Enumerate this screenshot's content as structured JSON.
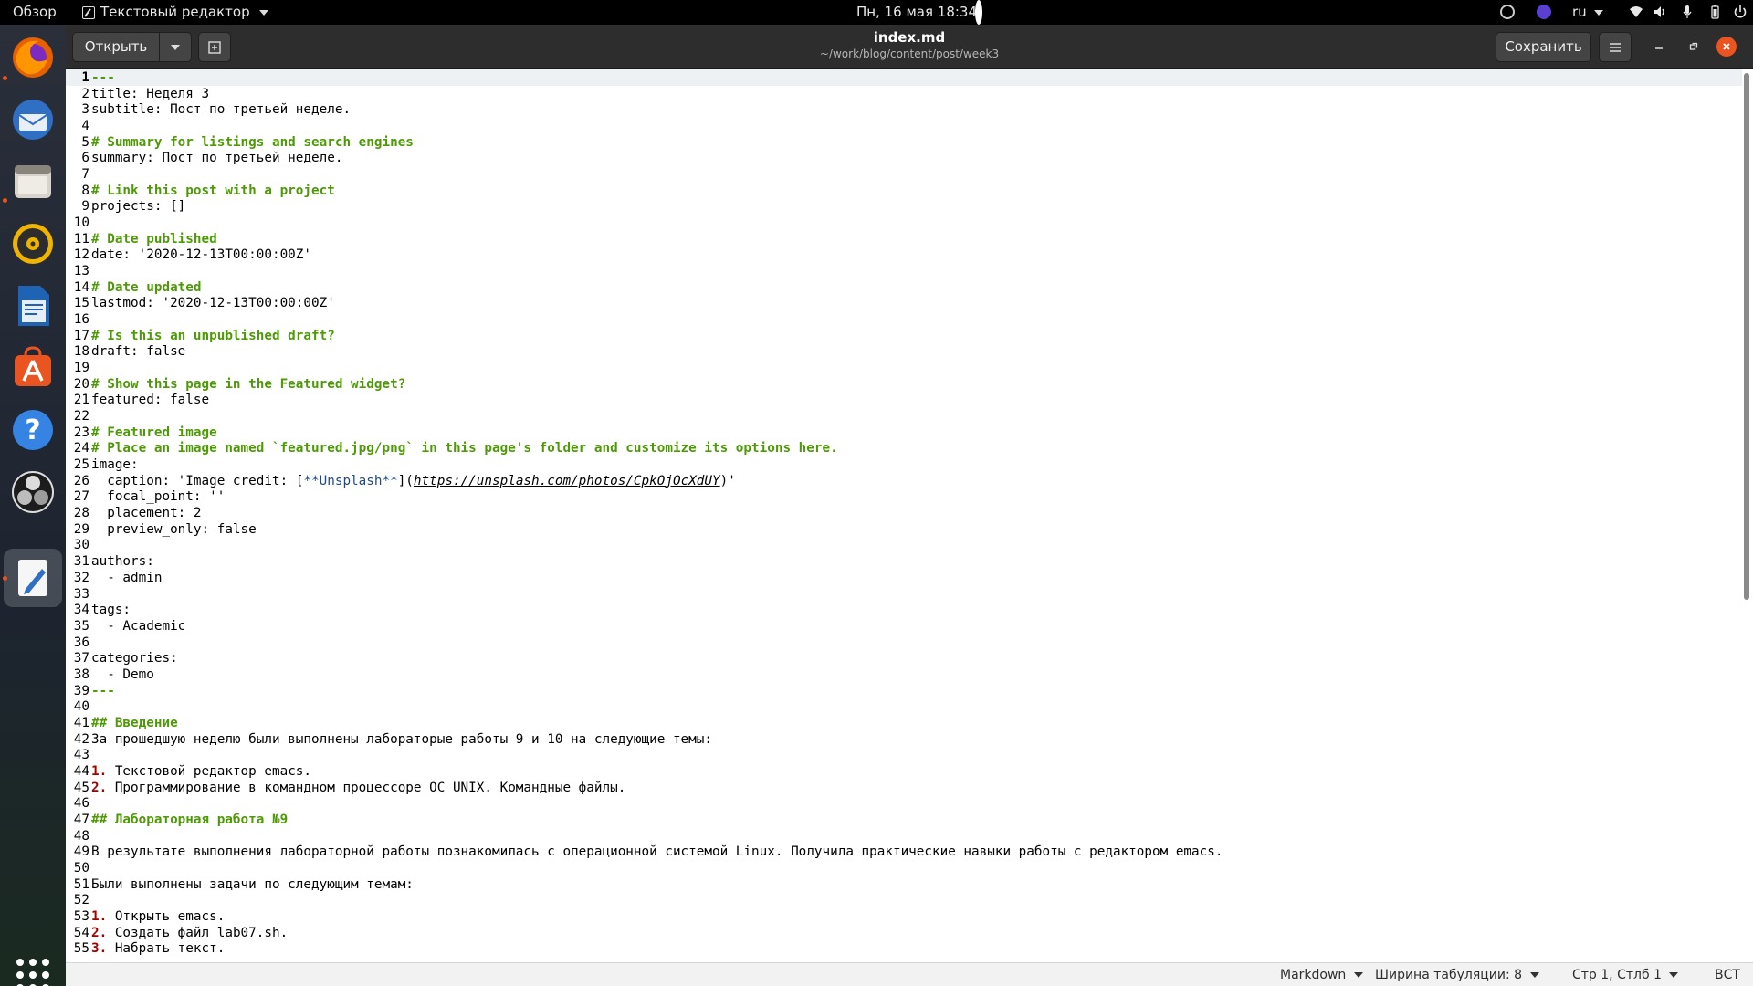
{
  "topbar": {
    "overview": "Обзор",
    "app_menu": "Текстовый редактор",
    "clock": "Пн, 16 мая  18:34",
    "lang": "ru"
  },
  "dock": {
    "items": [
      "firefox-icon",
      "thunderbird-icon",
      "files-icon",
      "rhythmbox-icon",
      "libreoffice-writer-icon",
      "software-center-icon",
      "help-icon",
      "obs-icon",
      "text-editor-icon"
    ]
  },
  "headerbar": {
    "open_label": "Открыть",
    "save_label": "Сохранить",
    "title": "index.md",
    "subtitle": "~/work/blog/content/post/week3"
  },
  "editor": {
    "lines": [
      {
        "n": "1",
        "segs": [
          {
            "t": "---",
            "c": "comment"
          }
        ]
      },
      {
        "n": "2",
        "segs": [
          {
            "t": "title: Неделя 3"
          }
        ]
      },
      {
        "n": "3",
        "segs": [
          {
            "t": "subtitle: Пост по третьей неделе."
          }
        ]
      },
      {
        "n": "4",
        "segs": []
      },
      {
        "n": "5",
        "segs": [
          {
            "t": "# Summary for listings and search engines",
            "c": "comment"
          }
        ]
      },
      {
        "n": "6",
        "segs": [
          {
            "t": "summary: Пост по третьей неделе."
          }
        ]
      },
      {
        "n": "7",
        "segs": []
      },
      {
        "n": "8",
        "segs": [
          {
            "t": "# Link this post with a project",
            "c": "comment"
          }
        ]
      },
      {
        "n": "9",
        "segs": [
          {
            "t": "projects: []"
          }
        ]
      },
      {
        "n": "10",
        "segs": []
      },
      {
        "n": "11",
        "segs": [
          {
            "t": "# Date published",
            "c": "comment"
          }
        ]
      },
      {
        "n": "12",
        "segs": [
          {
            "t": "date: '2020-12-13T00:00:00Z'"
          }
        ]
      },
      {
        "n": "13",
        "segs": []
      },
      {
        "n": "14",
        "segs": [
          {
            "t": "# Date updated",
            "c": "comment"
          }
        ]
      },
      {
        "n": "15",
        "segs": [
          {
            "t": "lastmod: '2020-12-13T00:00:00Z'"
          }
        ]
      },
      {
        "n": "16",
        "segs": []
      },
      {
        "n": "17",
        "segs": [
          {
            "t": "# Is this an unpublished draft?",
            "c": "comment"
          }
        ]
      },
      {
        "n": "18",
        "segs": [
          {
            "t": "draft: false"
          }
        ]
      },
      {
        "n": "19",
        "segs": []
      },
      {
        "n": "20",
        "segs": [
          {
            "t": "# Show this page in the Featured widget?",
            "c": "comment"
          }
        ]
      },
      {
        "n": "21",
        "segs": [
          {
            "t": "featured: false"
          }
        ]
      },
      {
        "n": "22",
        "segs": []
      },
      {
        "n": "23",
        "segs": [
          {
            "t": "# Featured image",
            "c": "comment"
          }
        ]
      },
      {
        "n": "24",
        "segs": [
          {
            "t": "# Place an image named `featured.jpg/png` in this page's folder and customize its options here.",
            "c": "comment"
          }
        ]
      },
      {
        "n": "25",
        "segs": [
          {
            "t": "image:"
          }
        ]
      },
      {
        "n": "26",
        "segs": [
          {
            "t": "  caption: 'Image credit: ["
          },
          {
            "t": "**Unsplash**",
            "c": "link"
          },
          {
            "t": "]("
          },
          {
            "t": "https://unsplash.com/photos/CpkOjOcXdUY",
            "c": "url"
          },
          {
            "t": ")'"
          }
        ]
      },
      {
        "n": "27",
        "segs": [
          {
            "t": "  focal_point: ''"
          }
        ]
      },
      {
        "n": "28",
        "segs": [
          {
            "t": "  placement: 2"
          }
        ]
      },
      {
        "n": "29",
        "segs": [
          {
            "t": "  preview_only: false"
          }
        ]
      },
      {
        "n": "30",
        "segs": []
      },
      {
        "n": "31",
        "segs": [
          {
            "t": "authors:"
          }
        ]
      },
      {
        "n": "32",
        "segs": [
          {
            "t": "  - admin"
          }
        ]
      },
      {
        "n": "33",
        "segs": []
      },
      {
        "n": "34",
        "segs": [
          {
            "t": "tags:"
          }
        ]
      },
      {
        "n": "35",
        "segs": [
          {
            "t": "  - Academic"
          }
        ]
      },
      {
        "n": "36",
        "segs": []
      },
      {
        "n": "37",
        "segs": [
          {
            "t": "categories:"
          }
        ]
      },
      {
        "n": "38",
        "segs": [
          {
            "t": "  - Demo"
          }
        ]
      },
      {
        "n": "39",
        "segs": [
          {
            "t": "---",
            "c": "comment"
          }
        ]
      },
      {
        "n": "40",
        "segs": []
      },
      {
        "n": "41",
        "segs": [
          {
            "t": "## Введение",
            "c": "heading"
          }
        ]
      },
      {
        "n": "42",
        "segs": [
          {
            "t": "За прошедшую неделю были выполнены лабораторые работы 9 и 10 на следующие темы:"
          }
        ]
      },
      {
        "n": "43",
        "segs": []
      },
      {
        "n": "44",
        "segs": [
          {
            "t": "1.",
            "c": "num"
          },
          {
            "t": " Текстовой редактор emacs."
          }
        ]
      },
      {
        "n": "45",
        "segs": [
          {
            "t": "2.",
            "c": "num"
          },
          {
            "t": " Программирование в командном процессоре ОС UNIX. Командные файлы."
          }
        ]
      },
      {
        "n": "46",
        "segs": []
      },
      {
        "n": "47",
        "segs": [
          {
            "t": "## Лабораторная работа №9",
            "c": "heading"
          }
        ]
      },
      {
        "n": "48",
        "segs": []
      },
      {
        "n": "49",
        "segs": [
          {
            "t": "В результате выполнения лабораторной работы познакомилась с операционной системой Linux. Получила практические навыки работы с редактором emacs."
          }
        ]
      },
      {
        "n": "50",
        "segs": []
      },
      {
        "n": "51",
        "segs": [
          {
            "t": "Были выполнены задачи по следующим темам:"
          }
        ]
      },
      {
        "n": "52",
        "segs": []
      },
      {
        "n": "53",
        "segs": [
          {
            "t": "1.",
            "c": "num"
          },
          {
            "t": " Открыть emacs."
          }
        ]
      },
      {
        "n": "54",
        "segs": [
          {
            "t": "2.",
            "c": "num"
          },
          {
            "t": " Создать файл lab07.sh."
          }
        ]
      },
      {
        "n": "55",
        "segs": [
          {
            "t": "3.",
            "c": "num"
          },
          {
            "t": " Набрать текст."
          }
        ]
      }
    ]
  },
  "statusbar": {
    "language": "Markdown",
    "tab_width": "Ширина табуляции: 8",
    "position": "Стр 1, Стлб 1",
    "mode": "ВСТ"
  }
}
